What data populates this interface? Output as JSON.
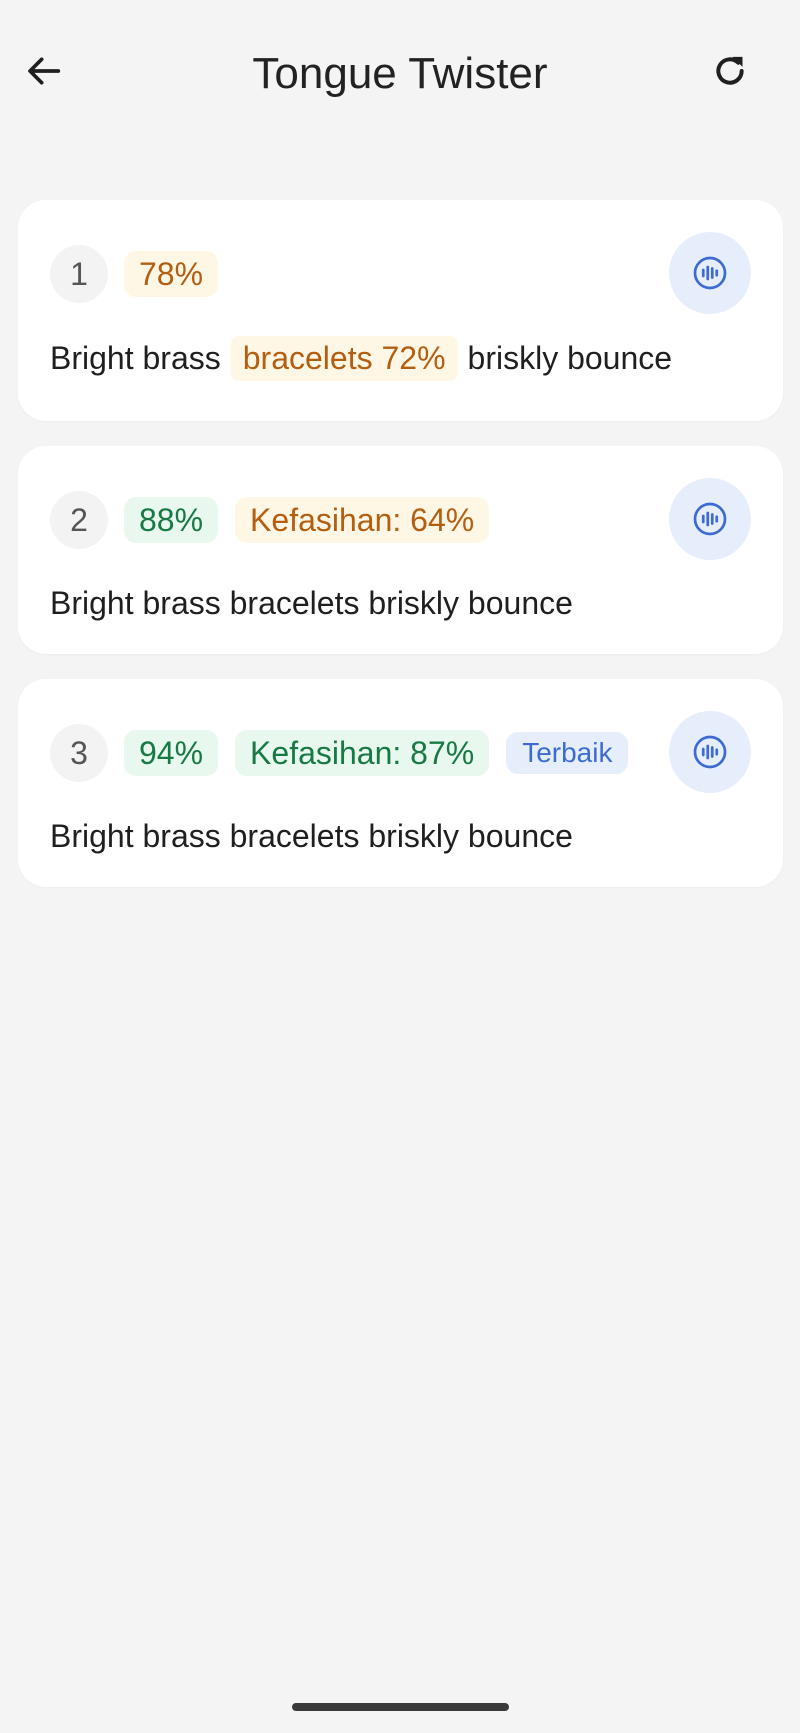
{
  "header": {
    "title": "Tongue Twister"
  },
  "icons": {
    "back": "arrow-left-icon",
    "refresh": "refresh-icon",
    "audio": "audio-waveform-icon"
  },
  "colors": {
    "warn_text": "#b45e10",
    "warn_bg": "#fff7e6",
    "good_text": "#177a45",
    "good_bg": "#e9f8ee",
    "accent": "#3d6bd1",
    "accent_bg": "#e6eefc"
  },
  "attempts": [
    {
      "number": "1",
      "score": "78%",
      "sentence_before": "Bright brass",
      "highlight": "bracelets 72%",
      "sentence_after": "briskly bounce"
    },
    {
      "number": "2",
      "score": "88%",
      "fluency": "Kefasihan: 64%",
      "sentence": "Bright brass bracelets briskly bounce"
    },
    {
      "number": "3",
      "score": "94%",
      "fluency": "Kefasihan: 87%",
      "badge": "Terbaik",
      "sentence": "Bright brass bracelets briskly bounce"
    }
  ]
}
